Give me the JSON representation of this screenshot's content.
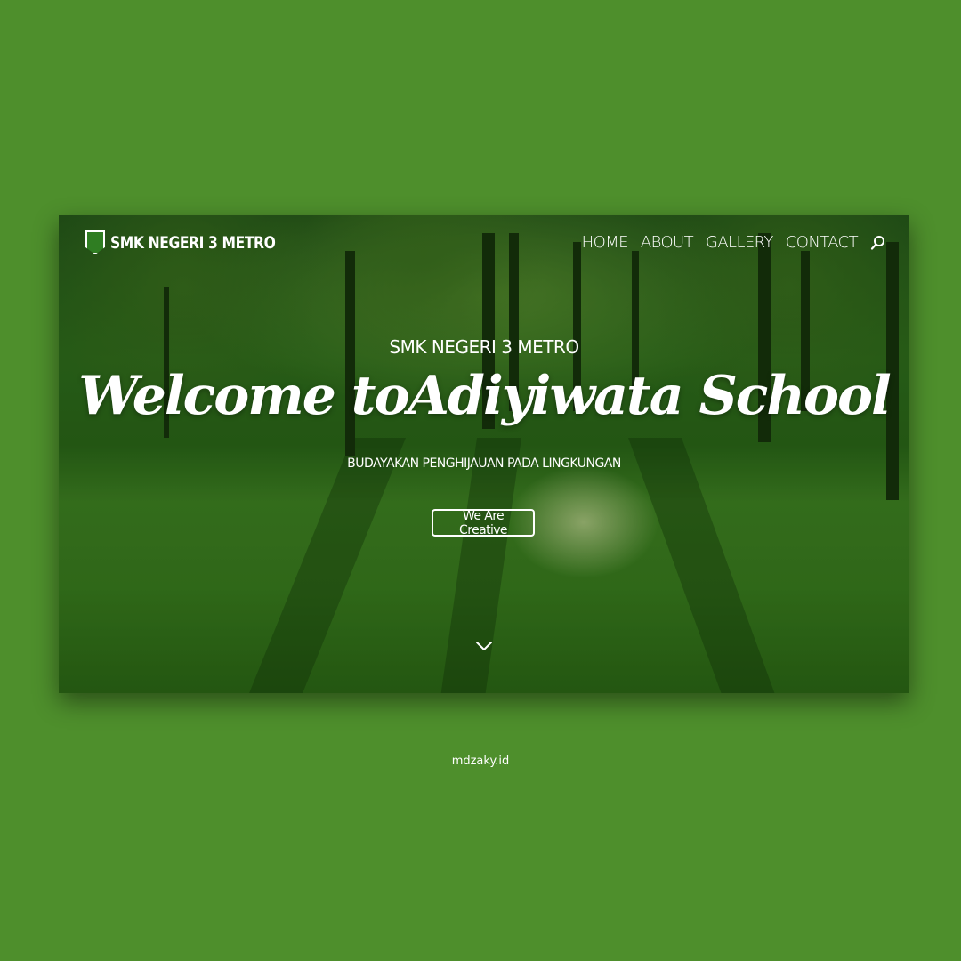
{
  "brand": {
    "name": "SMK NEGERI 3 METRO",
    "crest_color": "#2f7d22"
  },
  "nav": {
    "items": [
      "HOME",
      "ABOUT",
      "GALLERY",
      "CONTACT"
    ],
    "search_icon": "search-icon"
  },
  "hero": {
    "eyebrow": "SMK NEGERI 3 METRO",
    "headline": "Welcome toAdiyiwata School",
    "tagline": "BUDAYAKAN PENGHIJAUAN PADA LINGKUNGAN",
    "cta_label": "We Are Creative",
    "scroll_icon": "chevron-down-icon"
  },
  "credit": "mdzaky.id",
  "colors": {
    "background": "#4e8f2c",
    "text": "#ffffff"
  }
}
